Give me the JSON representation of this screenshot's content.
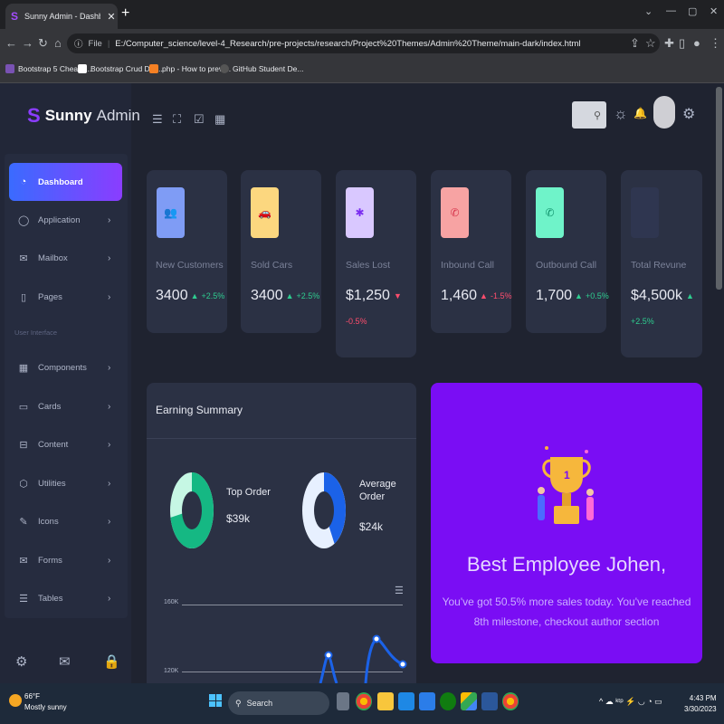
{
  "browser": {
    "tab_title": "Sunny Admin - Dashboard",
    "tab_close": "✕",
    "new_tab": "+",
    "window_controls": [
      "⌄",
      "—",
      "▢",
      "✕"
    ],
    "url_scheme": "File",
    "url": "E:/Computer_science/level-4_Research/pre-projects/research/Project%20Themes/Admin%20Theme/main-dark/index.html",
    "bookmarks": [
      {
        "label": "Bootstrap 5 CheatS...",
        "color": "#7952b3"
      },
      {
        "label": "Bootstrap Crud Dat...",
        "color": "#ffffff"
      },
      {
        "label": "php - How to previ...",
        "color": "#f48024"
      },
      {
        "label": "GitHub Student De...",
        "color": "#333333"
      }
    ]
  },
  "logo": {
    "brand": "Sunny",
    "suffix": "Admin"
  },
  "sidebar": {
    "items": [
      {
        "label": "Dashboard",
        "icon": "◔",
        "active": true
      },
      {
        "label": "Application",
        "icon": "◯",
        "chevron": "›"
      },
      {
        "label": "Mailbox",
        "icon": "✉",
        "chevron": "›"
      },
      {
        "label": "Pages",
        "icon": "▯",
        "chevron": "›"
      }
    ],
    "section_label": "User Interface",
    "ui_items": [
      {
        "label": "Components",
        "icon": "▦",
        "chevron": "›"
      },
      {
        "label": "Cards",
        "icon": "▭",
        "chevron": "›"
      },
      {
        "label": "Content",
        "icon": "⊟",
        "chevron": "›"
      },
      {
        "label": "Utilities",
        "icon": "⬡",
        "chevron": "›"
      },
      {
        "label": "Icons",
        "icon": "✎",
        "chevron": "›"
      },
      {
        "label": "Forms",
        "icon": "✉",
        "chevron": "›"
      },
      {
        "label": "Tables",
        "icon": "☰",
        "chevron": "›"
      }
    ],
    "footer_icons": [
      "⚙",
      "✉",
      "🔒"
    ]
  },
  "header": {
    "icons": [
      "☰",
      "⛶",
      "☑",
      "▦"
    ],
    "search_icon": "⚲",
    "right_icons": [
      "☼",
      "🔔",
      "⚙"
    ]
  },
  "stats": [
    {
      "label": "New Customers",
      "value": "3400",
      "change": "+2.5%",
      "dir": "up",
      "arrow": "▲",
      "icon": "👥",
      "bg": "#7f9cf5",
      "fg": "#2a46b8"
    },
    {
      "label": "Sold Cars",
      "value": "3400",
      "change": "+2.5%",
      "dir": "up",
      "arrow": "▲",
      "icon": "🚗",
      "bg": "#fcd77f",
      "fg": "#a46a00"
    },
    {
      "label": "Sales Lost",
      "value": "$1,250",
      "change": "-0.5%",
      "dir": "down",
      "arrow": "▼",
      "icon": "✱",
      "bg": "#d9c8ff",
      "fg": "#7a2cf0"
    },
    {
      "label": "Inbound Call",
      "value": "1,460",
      "change": "-1.5%",
      "dir": "down",
      "arrow": "▲",
      "icon": "✆",
      "bg": "#f7a3a3",
      "fg": "#d6334a"
    },
    {
      "label": "Outbound Call",
      "value": "1,700",
      "change": "+0.5%",
      "dir": "up",
      "arrow": "▲",
      "icon": "✆",
      "bg": "#6ff3c9",
      "fg": "#0d8f68"
    },
    {
      "label": "Total Revune",
      "value": "$4,500k",
      "change": "+2.5%",
      "dir": "up",
      "arrow": "▲",
      "icon": "",
      "bg": "#2f3650",
      "fg": "#2f3650"
    }
  ],
  "earning": {
    "title": "Earning Summary",
    "top_order": {
      "label": "Top Order",
      "value": "$39k",
      "fraction": 0.72
    },
    "average_order": {
      "label": "Average Order",
      "value": "$24k",
      "fraction": 0.42
    },
    "menu_icon": "☰",
    "chart_ticks": [
      "160K",
      "120K"
    ]
  },
  "promo": {
    "title": "Best Employee Johen,",
    "text": "You've got 50.5% more sales today. You've reached 8th milestone, checkout author section"
  },
  "taskbar": {
    "temp": "66°F",
    "condition": "Mostly sunny",
    "search": "Search",
    "time": "4:43 PM",
    "date": "3/30/2023",
    "tray": "^  ☁  ᵏᵗᵖ  ⚡ ◡ ◔ ▭"
  },
  "colors": {
    "accent": "#8a3dff",
    "promo": "#7a0df4",
    "up": "#2ecc8f",
    "down": "#ff4d6d"
  }
}
